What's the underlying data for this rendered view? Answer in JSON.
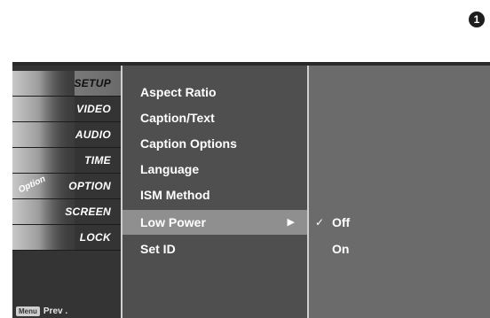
{
  "step_badge": "1",
  "sidebar": {
    "items": [
      {
        "label": "SETUP",
        "icon": "setup-icon",
        "selected": true
      },
      {
        "label": "VIDEO",
        "icon": "video-icon"
      },
      {
        "label": "AUDIO",
        "icon": "audio-icon"
      },
      {
        "label": "TIME",
        "icon": "time-icon"
      },
      {
        "label": "OPTION",
        "icon": "option-icon",
        "thumb_text": "Option"
      },
      {
        "label": "SCREEN",
        "icon": "screen-icon"
      },
      {
        "label": "LOCK",
        "icon": "lock-icon"
      }
    ],
    "prev_key": "Menu",
    "prev_label": "Prev ."
  },
  "menu": {
    "items": [
      {
        "label": "Aspect Ratio"
      },
      {
        "label": "Caption/Text"
      },
      {
        "label": "Caption Options"
      },
      {
        "label": "Language"
      },
      {
        "label": "ISM Method"
      },
      {
        "label": "Low Power",
        "active": true,
        "arrow": "▶"
      },
      {
        "label": "Set ID"
      }
    ]
  },
  "submenu": {
    "items": [
      {
        "label": "Off",
        "checked": true,
        "check": "✓"
      },
      {
        "label": "On",
        "checked": false
      }
    ]
  },
  "colors": {
    "osd_bg": "#4f4f4f",
    "highlight": "#8f8f8f",
    "submenu_bg": "#6b6b6b"
  }
}
